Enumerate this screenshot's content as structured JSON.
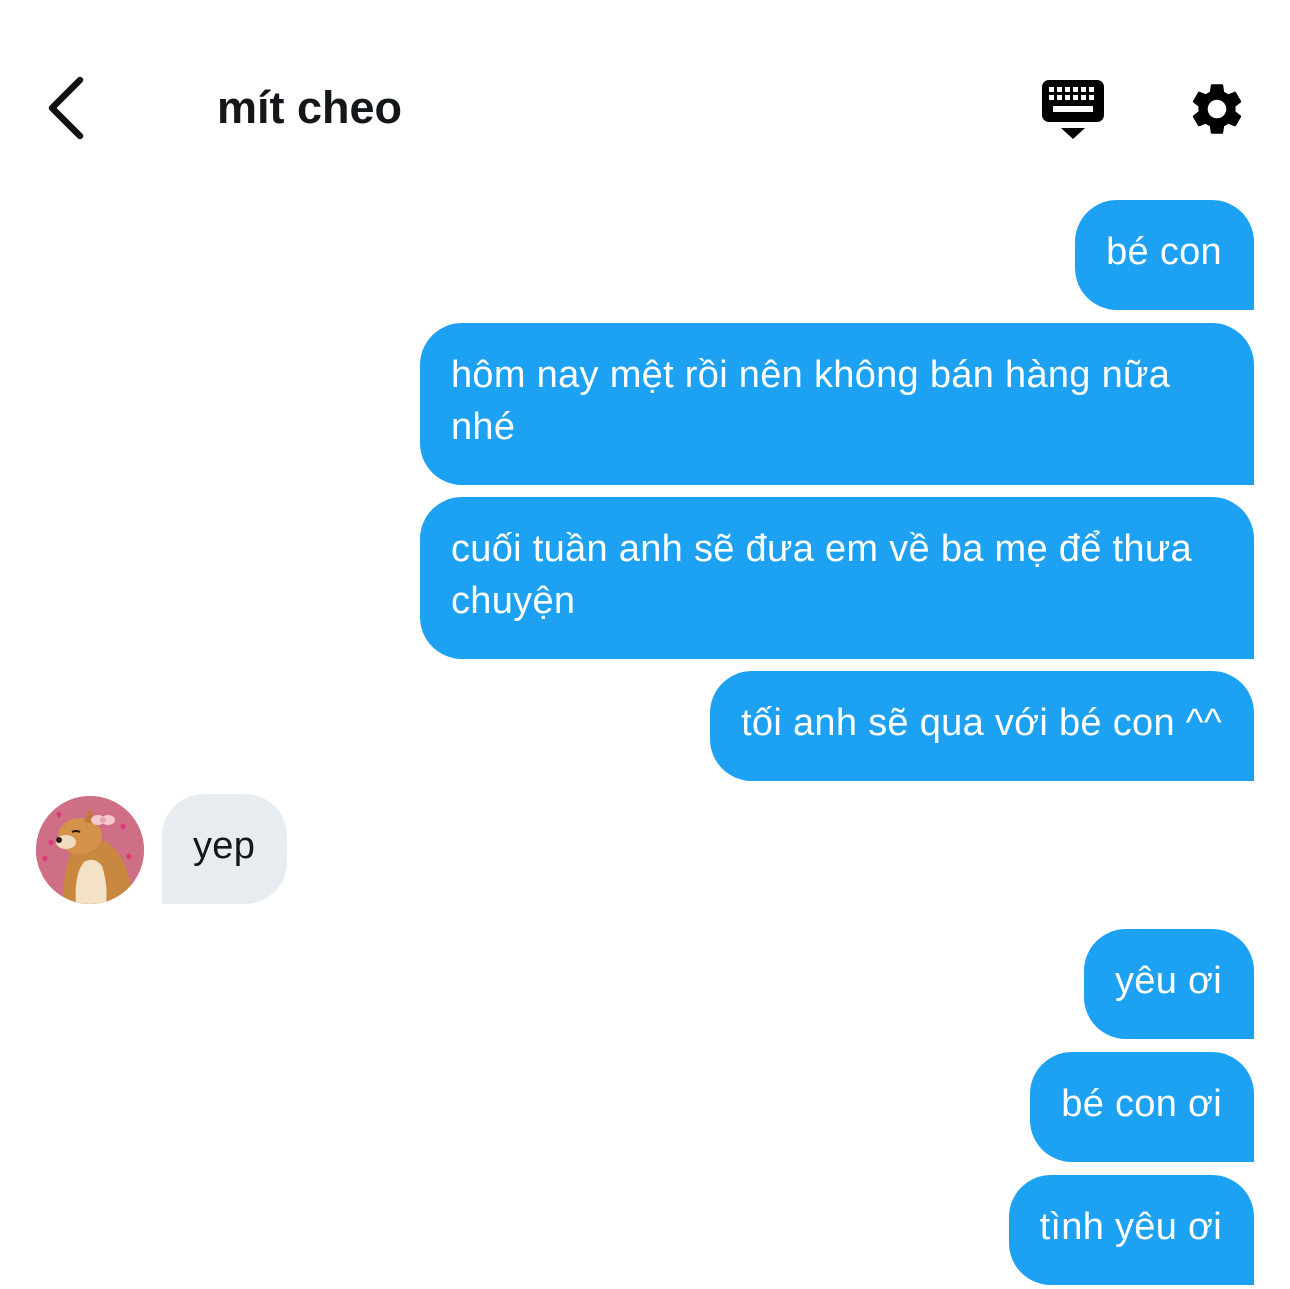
{
  "header": {
    "title": "mít cheo",
    "back_icon": "chevron-left-icon",
    "keyboard_icon": "keyboard-icon",
    "settings_icon": "gear-icon"
  },
  "messages": [
    {
      "direction": "outgoing",
      "text": "bé con"
    },
    {
      "direction": "outgoing",
      "text": "hôm nay mệt rồi nên không bán hàng nữa nhé"
    },
    {
      "direction": "outgoing",
      "text": "cuối tuần anh sẽ đưa em về ba mẹ để thưa chuyện"
    },
    {
      "direction": "outgoing",
      "text": "tối anh sẽ qua với bé con ^^"
    },
    {
      "direction": "incoming",
      "text": "yep"
    },
    {
      "direction": "outgoing",
      "text": "yêu ơi"
    },
    {
      "direction": "outgoing",
      "text": "bé con ơi"
    },
    {
      "direction": "outgoing",
      "text": "tình yêu ơi"
    }
  ],
  "colors": {
    "outgoing_bubble": "#1da1f2",
    "incoming_bubble": "#e6ecf0",
    "title_text": "#14171a"
  }
}
